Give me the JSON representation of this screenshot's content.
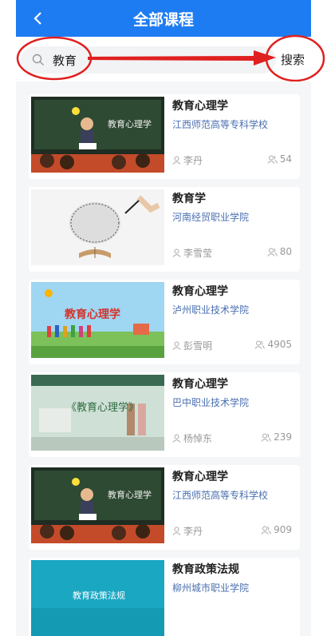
{
  "header": {
    "title": "全部课程",
    "back_icon": "chevron-left-icon"
  },
  "search": {
    "query": "教育",
    "button_label": "搜索"
  },
  "colors": {
    "primary": "#1e7cf2",
    "annotation": "#e02020",
    "school_text": "#4a6fb0"
  },
  "courses": [
    {
      "title": "教育心理学",
      "school": "江西师范高等专科学校",
      "teacher": "李丹",
      "count": "54",
      "thumb_text": "教育心理学"
    },
    {
      "title": "教育学",
      "school": "河南经贸职业学院",
      "teacher": "李雪莹",
      "count": "80",
      "thumb_text": ""
    },
    {
      "title": "教育心理学",
      "school": "泸州职业技术学院",
      "teacher": "彭雪明",
      "count": "4905",
      "thumb_text": "教育心理学"
    },
    {
      "title": "教育心理学",
      "school": "巴中职业技术学院",
      "teacher": "杨悼东",
      "count": "239",
      "thumb_text": "《教育心理学》"
    },
    {
      "title": "教育心理学",
      "school": "江西师范高等专科学校",
      "teacher": "李丹",
      "count": "909",
      "thumb_text": "教育心理学"
    },
    {
      "title": "教育政策法规",
      "school": "柳州城市职业学院",
      "teacher": "",
      "count": "",
      "thumb_text": "教育政策法规"
    }
  ]
}
